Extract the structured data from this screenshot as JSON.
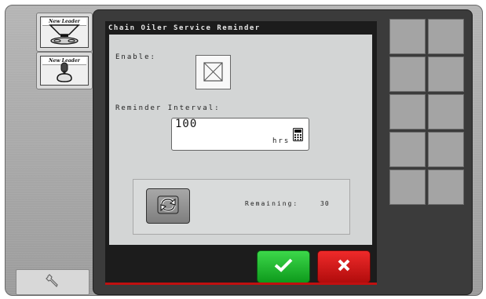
{
  "sidebar": {
    "buttons": [
      {
        "logo": "New Leader",
        "icon": "spreader-icon"
      },
      {
        "logo": "New Leader",
        "icon": "joystick-icon"
      }
    ],
    "tool_icon": "wrench-icon"
  },
  "dialog": {
    "title": "Chain Oiler Service Reminder",
    "enable_label": "Enable:",
    "interval_label": "Reminder Interval:",
    "interval_value": "100",
    "interval_unit": "hrs",
    "remaining_label": "Remaining:",
    "remaining_value": "30",
    "enable_checked": false
  },
  "actions": {
    "ok_icon": "checkmark-icon",
    "cancel_icon": "x-icon",
    "ok_color": "#1cb02a",
    "cancel_color": "#d41818"
  }
}
